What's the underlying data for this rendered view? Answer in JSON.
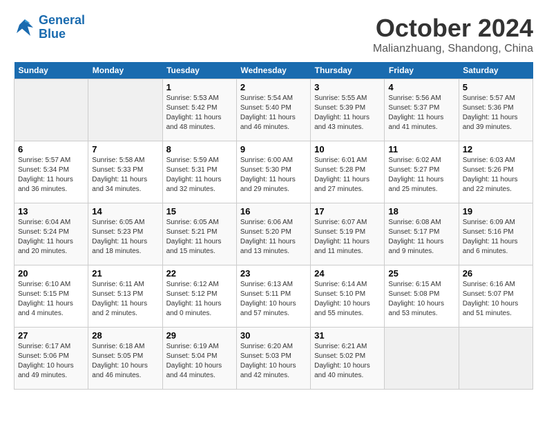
{
  "header": {
    "logo_line1": "General",
    "logo_line2": "Blue",
    "month": "October 2024",
    "location": "Malianzhuang, Shandong, China"
  },
  "weekdays": [
    "Sunday",
    "Monday",
    "Tuesday",
    "Wednesday",
    "Thursday",
    "Friday",
    "Saturday"
  ],
  "weeks": [
    [
      {
        "day": "",
        "info": ""
      },
      {
        "day": "",
        "info": ""
      },
      {
        "day": "1",
        "info": "Sunrise: 5:53 AM\nSunset: 5:42 PM\nDaylight: 11 hours and 48 minutes."
      },
      {
        "day": "2",
        "info": "Sunrise: 5:54 AM\nSunset: 5:40 PM\nDaylight: 11 hours and 46 minutes."
      },
      {
        "day": "3",
        "info": "Sunrise: 5:55 AM\nSunset: 5:39 PM\nDaylight: 11 hours and 43 minutes."
      },
      {
        "day": "4",
        "info": "Sunrise: 5:56 AM\nSunset: 5:37 PM\nDaylight: 11 hours and 41 minutes."
      },
      {
        "day": "5",
        "info": "Sunrise: 5:57 AM\nSunset: 5:36 PM\nDaylight: 11 hours and 39 minutes."
      }
    ],
    [
      {
        "day": "6",
        "info": "Sunrise: 5:57 AM\nSunset: 5:34 PM\nDaylight: 11 hours and 36 minutes."
      },
      {
        "day": "7",
        "info": "Sunrise: 5:58 AM\nSunset: 5:33 PM\nDaylight: 11 hours and 34 minutes."
      },
      {
        "day": "8",
        "info": "Sunrise: 5:59 AM\nSunset: 5:31 PM\nDaylight: 11 hours and 32 minutes."
      },
      {
        "day": "9",
        "info": "Sunrise: 6:00 AM\nSunset: 5:30 PM\nDaylight: 11 hours and 29 minutes."
      },
      {
        "day": "10",
        "info": "Sunrise: 6:01 AM\nSunset: 5:28 PM\nDaylight: 11 hours and 27 minutes."
      },
      {
        "day": "11",
        "info": "Sunrise: 6:02 AM\nSunset: 5:27 PM\nDaylight: 11 hours and 25 minutes."
      },
      {
        "day": "12",
        "info": "Sunrise: 6:03 AM\nSunset: 5:26 PM\nDaylight: 11 hours and 22 minutes."
      }
    ],
    [
      {
        "day": "13",
        "info": "Sunrise: 6:04 AM\nSunset: 5:24 PM\nDaylight: 11 hours and 20 minutes."
      },
      {
        "day": "14",
        "info": "Sunrise: 6:05 AM\nSunset: 5:23 PM\nDaylight: 11 hours and 18 minutes."
      },
      {
        "day": "15",
        "info": "Sunrise: 6:05 AM\nSunset: 5:21 PM\nDaylight: 11 hours and 15 minutes."
      },
      {
        "day": "16",
        "info": "Sunrise: 6:06 AM\nSunset: 5:20 PM\nDaylight: 11 hours and 13 minutes."
      },
      {
        "day": "17",
        "info": "Sunrise: 6:07 AM\nSunset: 5:19 PM\nDaylight: 11 hours and 11 minutes."
      },
      {
        "day": "18",
        "info": "Sunrise: 6:08 AM\nSunset: 5:17 PM\nDaylight: 11 hours and 9 minutes."
      },
      {
        "day": "19",
        "info": "Sunrise: 6:09 AM\nSunset: 5:16 PM\nDaylight: 11 hours and 6 minutes."
      }
    ],
    [
      {
        "day": "20",
        "info": "Sunrise: 6:10 AM\nSunset: 5:15 PM\nDaylight: 11 hours and 4 minutes."
      },
      {
        "day": "21",
        "info": "Sunrise: 6:11 AM\nSunset: 5:13 PM\nDaylight: 11 hours and 2 minutes."
      },
      {
        "day": "22",
        "info": "Sunrise: 6:12 AM\nSunset: 5:12 PM\nDaylight: 11 hours and 0 minutes."
      },
      {
        "day": "23",
        "info": "Sunrise: 6:13 AM\nSunset: 5:11 PM\nDaylight: 10 hours and 57 minutes."
      },
      {
        "day": "24",
        "info": "Sunrise: 6:14 AM\nSunset: 5:10 PM\nDaylight: 10 hours and 55 minutes."
      },
      {
        "day": "25",
        "info": "Sunrise: 6:15 AM\nSunset: 5:08 PM\nDaylight: 10 hours and 53 minutes."
      },
      {
        "day": "26",
        "info": "Sunrise: 6:16 AM\nSunset: 5:07 PM\nDaylight: 10 hours and 51 minutes."
      }
    ],
    [
      {
        "day": "27",
        "info": "Sunrise: 6:17 AM\nSunset: 5:06 PM\nDaylight: 10 hours and 49 minutes."
      },
      {
        "day": "28",
        "info": "Sunrise: 6:18 AM\nSunset: 5:05 PM\nDaylight: 10 hours and 46 minutes."
      },
      {
        "day": "29",
        "info": "Sunrise: 6:19 AM\nSunset: 5:04 PM\nDaylight: 10 hours and 44 minutes."
      },
      {
        "day": "30",
        "info": "Sunrise: 6:20 AM\nSunset: 5:03 PM\nDaylight: 10 hours and 42 minutes."
      },
      {
        "day": "31",
        "info": "Sunrise: 6:21 AM\nSunset: 5:02 PM\nDaylight: 10 hours and 40 minutes."
      },
      {
        "day": "",
        "info": ""
      },
      {
        "day": "",
        "info": ""
      }
    ]
  ]
}
